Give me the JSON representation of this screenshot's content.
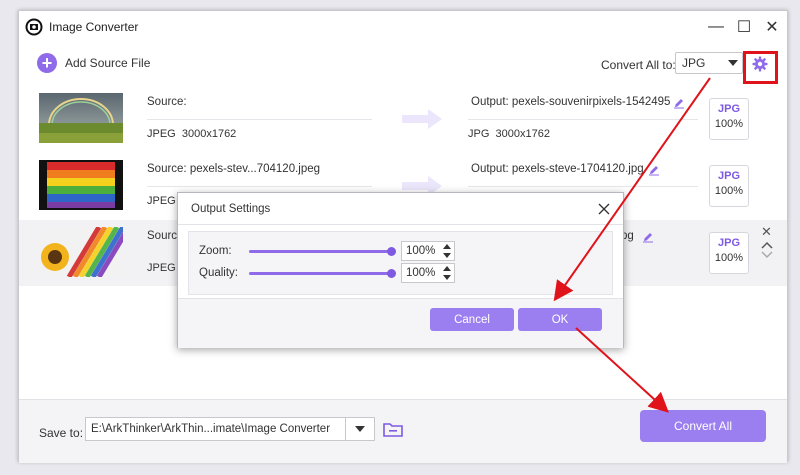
{
  "window": {
    "title": "Image Converter",
    "minimize": "—",
    "maximize": "☐",
    "close": "✕"
  },
  "toolbar": {
    "add_label": "Add Source File",
    "convert_all_label": "Convert All to:",
    "format_value": "JPG"
  },
  "files": [
    {
      "source": "Source:",
      "src_format": "JPEG",
      "src_size": "3000x1762",
      "output": "Output: pexels-souvenirpixels-1542495",
      "out_format": "JPG",
      "out_size": "3000x1762",
      "badge_fmt": "JPG",
      "badge_pct": "100%"
    },
    {
      "source": "Source: pexels-stev...704120.jpeg",
      "src_format": "JPEG",
      "output": "Output: pexels-steve-1704120.jpg",
      "badge_fmt": "JPG",
      "badge_pct": "100%"
    },
    {
      "source": "Source",
      "src_format": "JPEG",
      "output": "pg",
      "badge_fmt": "JPG",
      "badge_pct": "100%"
    }
  ],
  "dialog": {
    "title": "Output Settings",
    "zoom_label": "Zoom:",
    "zoom_value": "100%",
    "zoom_level": 1.0,
    "quality_label": "Quality:",
    "quality_value": "100%",
    "quality_level": 1.0,
    "cancel_label": "Cancel",
    "ok_label": "OK"
  },
  "bottom": {
    "save_label": "Save to:",
    "save_path": "E:\\ArkThinker\\ArkThin...imate\\Image Converter",
    "convert_label": "Convert All"
  },
  "colors": {
    "accent": "#8f6bea",
    "button": "#9b7ff0",
    "annotation": "#e0131a"
  },
  "icons": {
    "add": "plus-circle-icon",
    "gear": "gear-icon",
    "edit": "pencil-icon",
    "folder": "folder-icon",
    "close": "close-icon"
  }
}
